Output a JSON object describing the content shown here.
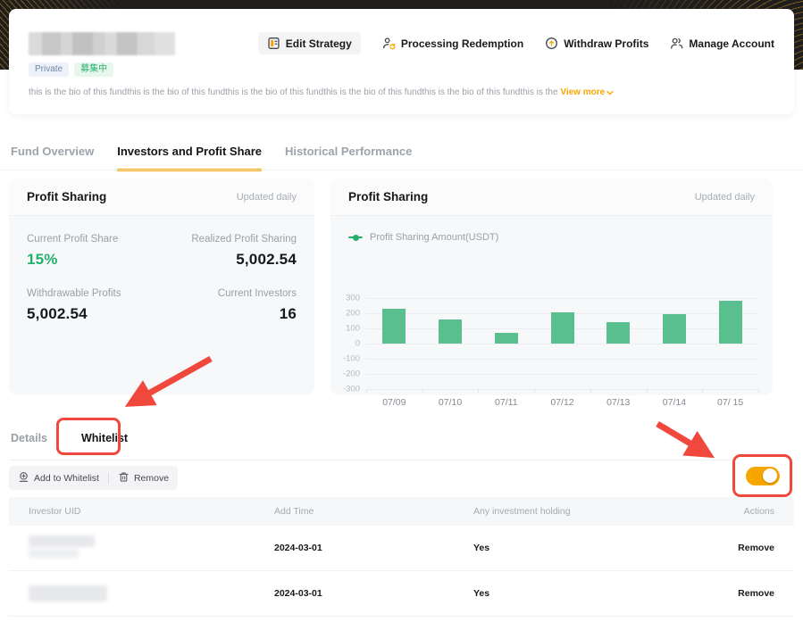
{
  "colors": {
    "accent_orange": "#f7a600",
    "positive_green": "#22b16c",
    "bar_green": "#5abf8e",
    "legend_green": "#27ae6c",
    "annotation_red": "#f0483c",
    "banner_dark": "#1f1e1c"
  },
  "header": {
    "badges": [
      {
        "label": "Private"
      },
      {
        "label": "募集中"
      }
    ],
    "actions": [
      {
        "label": "Edit Strategy"
      },
      {
        "label": "Processing Redemption"
      },
      {
        "label": "Withdraw Profits"
      },
      {
        "label": "Manage Account"
      }
    ],
    "bio": "this is the bio of this fundthis is the bio of this fundthis is the bio of this fundthis is the bio of this fundthis is the bio of this fundthis is the ",
    "view_more_label": "View more"
  },
  "tabs": [
    {
      "label": "Fund Overview"
    },
    {
      "label": "Investors and Profit Share"
    },
    {
      "label": "Historical Performance"
    }
  ],
  "profit_summary": {
    "title": "Profit Sharing",
    "updated": "Updated daily",
    "stats": [
      {
        "label": "Current Profit Share",
        "value": "15%"
      },
      {
        "label": "Realized Profit Sharing",
        "value": "5,002.54"
      },
      {
        "label": "Withdrawable Profits",
        "value": "5,002.54"
      },
      {
        "label": "Current Investors",
        "value": "16"
      }
    ]
  },
  "chart_data": {
    "type": "bar",
    "title": "Profit Sharing",
    "updated": "Updated daily",
    "legend": "Profit Sharing Amount(USDT)",
    "legend_position": "top-left",
    "categories": [
      "07/09",
      "07/10",
      "07/11",
      "07/12",
      "07/13",
      "07/14",
      "07/ 15"
    ],
    "values": [
      230,
      160,
      70,
      205,
      140,
      195,
      280
    ],
    "ylim": [
      -300,
      300
    ],
    "yticks": [
      300,
      200,
      100,
      0,
      -100,
      -200,
      -300
    ],
    "grid": true,
    "bar_color": "#5abf8e"
  },
  "sub_tabs": [
    {
      "label": "Details"
    },
    {
      "label": "Whitelist"
    }
  ],
  "whitelist": {
    "toolbar": {
      "add_label": "Add to Whitelist",
      "remove_label": "Remove"
    },
    "toggle_on": true,
    "table": {
      "columns": [
        "Investor UID",
        "Add Time",
        "Any investment holding",
        "Actions"
      ],
      "rows": [
        {
          "add_time": "2024-03-01",
          "holding": "Yes",
          "action": "Remove"
        },
        {
          "add_time": "2024-03-01",
          "holding": "Yes",
          "action": "Remove"
        }
      ]
    }
  }
}
